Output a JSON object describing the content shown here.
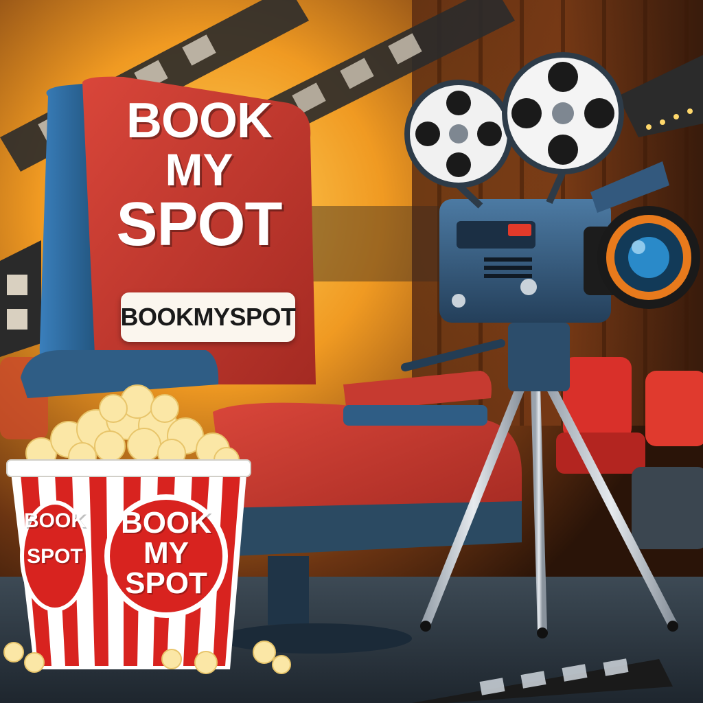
{
  "scene": {
    "subject": "cinema",
    "colors": {
      "background_glow": "#f5a623",
      "curtain": "#5a2a14",
      "seat_red": "#c8342a",
      "seat_blue": "#2f6fa6",
      "popcorn_red": "#d8231f",
      "camera_blue": "#355f86"
    }
  },
  "chair": {
    "title_line1": "BOOK",
    "title_line2": "MY",
    "title_line3": "SPOT",
    "tag_text": "BOOKMYSPOT"
  },
  "popcorn_bucket": {
    "badge_large_line1": "BOOK",
    "badge_large_line2": "MY",
    "badge_large_line3": "SPOT",
    "badge_small_line1": "BOOK",
    "badge_small_line2": "SPOT"
  },
  "icons": [
    "film-strip-icon",
    "film-reel-icon",
    "movie-camera-icon",
    "popcorn-icon",
    "theater-seat-icon"
  ]
}
